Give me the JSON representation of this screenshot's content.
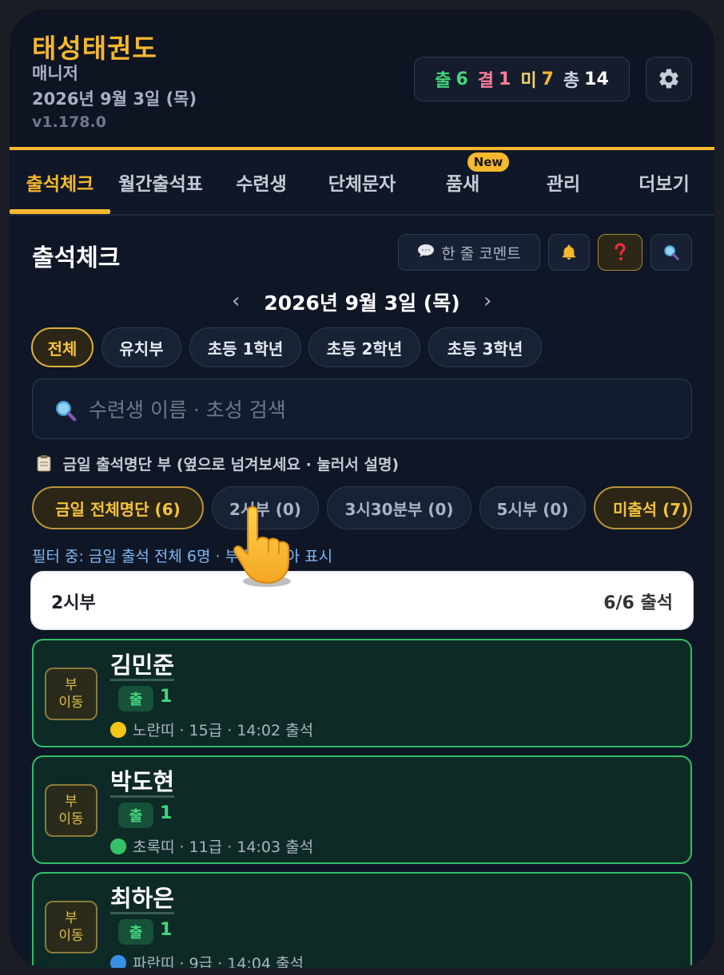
{
  "header": {
    "title": "태성태권도",
    "role": "매니저",
    "date": "2026년 9월 3일 (목)",
    "version": "v1.178.0",
    "stats": {
      "present_label": "출",
      "present": "6",
      "absent_label": "결",
      "absent": "1",
      "unchecked_label": "미",
      "unchecked": "7",
      "total_label": "총",
      "total": "14",
      "colors": {
        "present": "#43d67d",
        "absent": "#ff7e9a",
        "unchecked": "#f5b82e",
        "total": "#ffffff"
      }
    },
    "settings_icon": "gear-icon"
  },
  "tabs": [
    {
      "label": "출석체크",
      "active": true
    },
    {
      "label": "월간출석표"
    },
    {
      "label": "수련생"
    },
    {
      "label": "단체문자"
    },
    {
      "label": "품새",
      "badge": "New"
    },
    {
      "label": "관리"
    },
    {
      "label": "더보기"
    }
  ],
  "section": {
    "title": "출석체크",
    "comment_button": "한 줄 코멘트",
    "icons": [
      "speech-bubble-icon",
      "bell-icon",
      "question-icon",
      "search-icon"
    ]
  },
  "date_nav": {
    "prev": "‹",
    "label": "2026년 9월 3일 (목)",
    "next": "›"
  },
  "groups": [
    "전체",
    "유치부",
    "초등 1학년",
    "초등 2학년",
    "초등 3학년"
  ],
  "search": {
    "placeholder": "수련생 이름 · 초성 검색",
    "value": ""
  },
  "roster_note": "금일 출석명단 부 (옆으로 넘겨보세요 · 눌러서 설명)",
  "sessions": [
    "금일 전체명단 (6)",
    "2시부 (0)",
    "3시30분부 (0)",
    "5시부 (0)",
    "미출석 (7)"
  ],
  "filter_note": "필터 중: 금일 출석 전체 6명 · 부별로 모아 표시",
  "group_card": {
    "title": "2시부",
    "count": "6/6 출석"
  },
  "students": [
    {
      "move_line1": "부",
      "move_line2": "이동",
      "name": "김민준",
      "badge": "출",
      "count": "1",
      "info": "노란띠 · 15급 · 14:02 출석",
      "belt_color": "#f5c518"
    },
    {
      "move_line1": "부",
      "move_line2": "이동",
      "name": "박도현",
      "badge": "출",
      "count": "1",
      "info": "초록띠 · 11급 · 14:03 출석",
      "belt_color": "#35c267"
    },
    {
      "move_line1": "부",
      "move_line2": "이동",
      "name": "최하은",
      "badge": "출",
      "count": "1",
      "info": "파란띠 · 9급 · 14:04 출석",
      "belt_color": "#3a8ee6"
    }
  ]
}
